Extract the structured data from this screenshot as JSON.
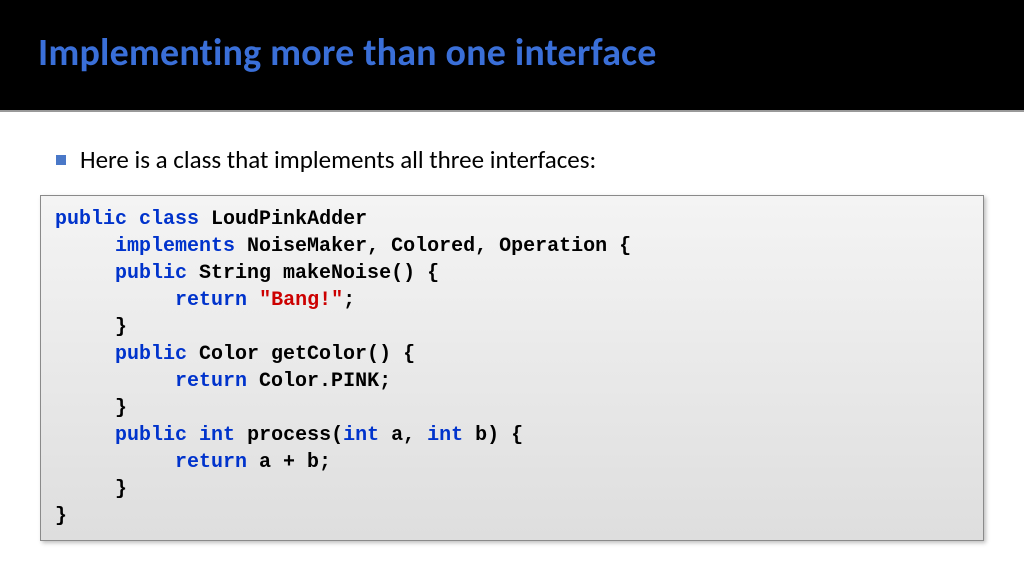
{
  "title": "Implementing more than one interface",
  "bullet": "Here is a class that implements all three interfaces:",
  "code": {
    "l1": {
      "k1": "public",
      "s1": " ",
      "k2": "class",
      "s2": " LoudPinkAdder"
    },
    "l2": {
      "sp": "     ",
      "k1": "implements",
      "s1": " NoiseMaker, Colored, Operation {"
    },
    "l3": {
      "sp": "     ",
      "k1": "public",
      "s1": " String makeNoise() {"
    },
    "l4": {
      "sp": "          ",
      "k1": "return",
      "s1": " ",
      "str": "\"Bang!\"",
      "s2": ";"
    },
    "l5": {
      "sp": "     ",
      "s1": "}"
    },
    "l6": {
      "sp": "     ",
      "k1": "public",
      "s1": " Color getColor() {"
    },
    "l7": {
      "sp": "          ",
      "k1": "return",
      "s1": " Color.PINK;"
    },
    "l8": {
      "sp": "     ",
      "s1": "}"
    },
    "l9": {
      "sp": "     ",
      "k1": "public",
      "s1": " ",
      "k2": "int",
      "s2": " process(",
      "k3": "int",
      "s3": " a, ",
      "k4": "int",
      "s4": " b) {"
    },
    "l10": {
      "sp": "          ",
      "k1": "return",
      "s1": " a + b;"
    },
    "l11": {
      "sp": "     ",
      "s1": "}"
    },
    "l12": {
      "s1": "}"
    }
  }
}
